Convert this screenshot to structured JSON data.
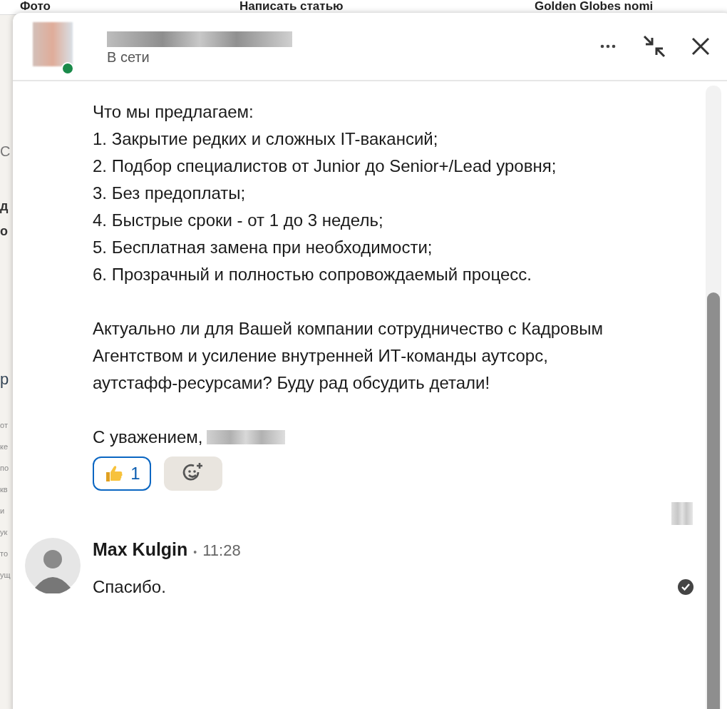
{
  "background": {
    "tabs": [
      {
        "label": "Фото"
      },
      {
        "label": "Написать статью"
      },
      {
        "label": "Golden Globes nomi"
      }
    ],
    "fragments": [
      {
        "text": "C",
        "kind": "muted"
      },
      {
        "text": "д",
        "kind": "bold"
      },
      {
        "text": "о",
        "kind": "bold"
      },
      {
        "text": "р",
        "kind": "heading"
      },
      {
        "text": "от",
        "kind": "small"
      },
      {
        "text": "ке",
        "kind": "small"
      },
      {
        "text": "по",
        "kind": "small"
      },
      {
        "text": "кв",
        "kind": "small"
      },
      {
        "text": "и",
        "kind": "small"
      },
      {
        "text": "ук",
        "kind": "small"
      },
      {
        "text": "то",
        "kind": "small"
      },
      {
        "text": "ущ",
        "kind": "small"
      }
    ]
  },
  "chat": {
    "status": "В сети",
    "online": true,
    "message": {
      "lines": [
        "Что мы предлагаем:",
        "1. Закрытие редких и сложных IT-вакансий;",
        "2. Подбор специалистов от Junior до Senior+/Lead уровня;",
        "3. Без предоплаты;",
        "4. Быстрые сроки - от 1 до 3 недель;",
        "5. Бесплатная замена при необходимости;",
        "6. Прозрачный и полностью сопровождаемый процесс."
      ],
      "question": "Актуально ли для Вашей компании сотрудничество с Кадровым Агентством и усиление внутренней ИТ-команды аутсорс, аутстафф-ресурсами? Буду рад обсудить детали!",
      "closing": "С уважением,",
      "reaction": {
        "count": "1",
        "selected": true
      }
    },
    "reply": {
      "author": "Max Kulgin",
      "dot": "•",
      "time": "11:28",
      "text": "Спасибо.",
      "read": true
    }
  }
}
